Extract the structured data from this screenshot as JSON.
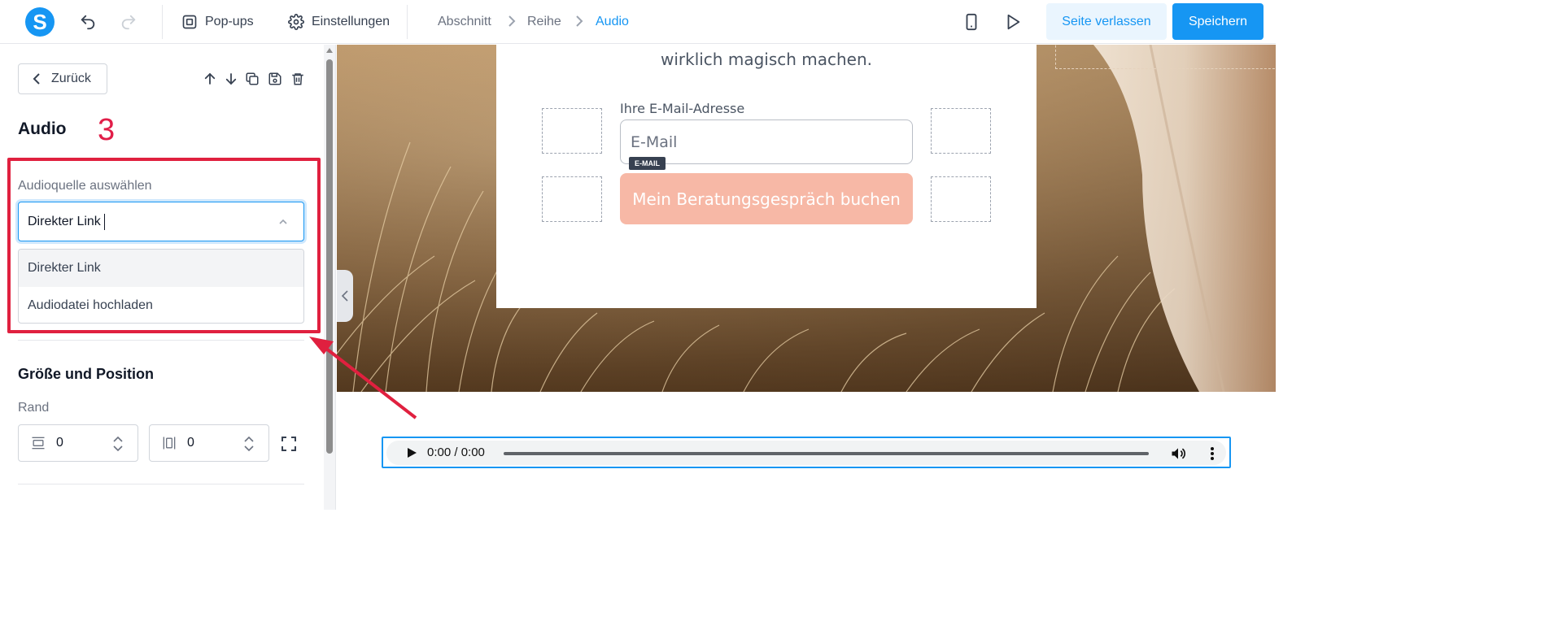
{
  "toolbar": {
    "logo_letter": "S",
    "popups_label": "Pop-ups",
    "settings_label": "Einstellungen",
    "breadcrumb": [
      "Abschnitt",
      "Reihe",
      "Audio"
    ],
    "leave_label": "Seite verlassen",
    "save_label": "Speichern"
  },
  "panel": {
    "back_label": "Zurück",
    "title": "Audio",
    "step_number": "3",
    "source_label": "Audioquelle auswählen",
    "source_value": "Direkter Link",
    "source_options": [
      "Direkter Link",
      "Audiodatei hochladen"
    ],
    "size_section_title": "Größe und Position",
    "margin_label": "Rand",
    "margin_vertical": "0",
    "margin_horizontal": "0"
  },
  "canvas": {
    "card_text": "wirklich magisch machen.",
    "email_label": "Ihre E-Mail-Adresse",
    "email_placeholder": "E-Mail",
    "email_badge": "E-MAIL",
    "cta_label": "Mein Beratungsgespräch buchen",
    "audio_time": "0:00 / 0:00"
  },
  "colors": {
    "accent": "#1696f3",
    "highlight": "#e0203f",
    "cta": "#f7b8a6"
  }
}
